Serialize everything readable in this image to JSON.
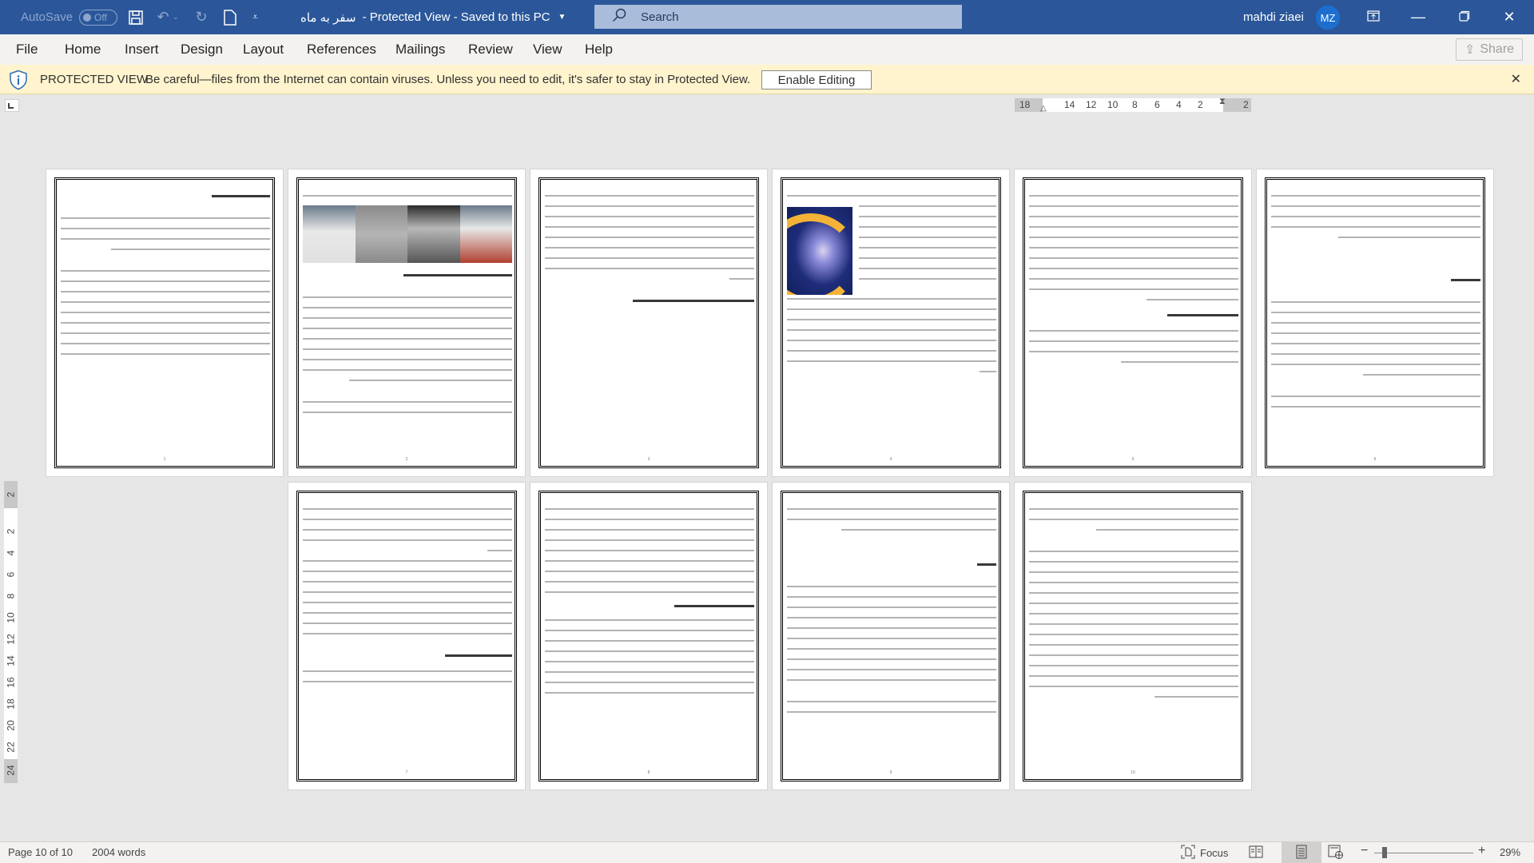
{
  "titlebar": {
    "autosave_label": "AutoSave",
    "autosave_state": "Off",
    "doc_name": "سفر به ماه",
    "doc_status": " - Protected View - Saved to this PC",
    "search_placeholder": "Search",
    "user_name": "mahdi ziaei",
    "user_initials": "MZ"
  },
  "ribbon": {
    "tabs": [
      "File",
      "Home",
      "Insert",
      "Design",
      "Layout",
      "References",
      "Mailings",
      "Review",
      "View",
      "Help"
    ],
    "share_label": "Share"
  },
  "protected_view": {
    "title": "PROTECTED VIEW",
    "message": "Be careful—files from the Internet can contain viruses. Unless you need to edit, it's safer to stay in Protected View.",
    "button_label": "Enable Editing"
  },
  "ruler": {
    "horizontal_ticks": [
      "18",
      "14",
      "12",
      "10",
      "8",
      "6",
      "4",
      "2",
      "2"
    ],
    "vertical_ticks": [
      "2",
      "2",
      "4",
      "6",
      "8",
      "10",
      "12",
      "14",
      "16",
      "18",
      "20",
      "22",
      "24"
    ]
  },
  "document": {
    "pages": [
      {
        "number": "1",
        "heading": "سفر به ماه"
      },
      {
        "number": "2",
        "heading": "پروژه آپولوها چگونه و برای چه چیزی خرج شده است؟",
        "subheading": "۱. سطح فناوری فضایی کشور آمریکا"
      },
      {
        "number": "3",
        "subheading": "۲. کمربند تشعشعی ون آلن و امواج الکترومغناطیس"
      },
      {
        "number": "4"
      },
      {
        "number": "5",
        "subheading": "۳. تأخیر در مکالمات با زمین"
      },
      {
        "number": "6",
        "subheading": "۴. ایرادهای فنی"
      },
      {
        "number": "7",
        "subheading": "۵. پرچمی که تکان می‌خورد"
      },
      {
        "number": "8",
        "subheading": "۶. یک تصویر برتر از دوصد گفتار"
      },
      {
        "number": "9",
        "subheading": "شواهد"
      },
      {
        "number": "10",
        "inline_text": "Lunar Laser Ranging"
      }
    ]
  },
  "statusbar": {
    "page_info": "Page 10 of 10",
    "word_count": "2004 words",
    "focus_label": "Focus",
    "zoom_level": "29%"
  }
}
